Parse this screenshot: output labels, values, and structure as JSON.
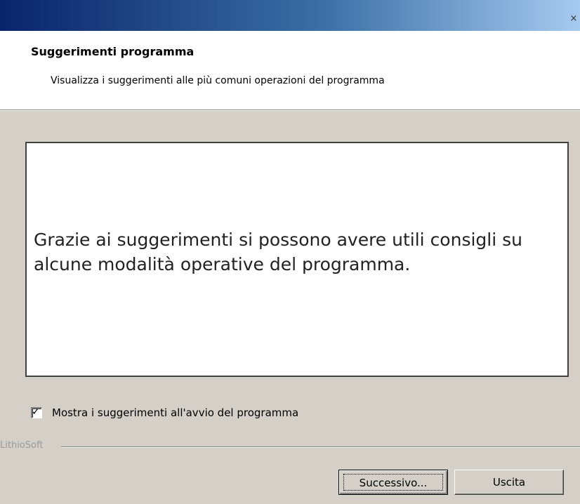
{
  "window": {
    "close_glyph": "×"
  },
  "header": {
    "title": "Suggerimenti programma",
    "subtitle": "Visualizza i suggerimenti alle più comuni operazioni del programma"
  },
  "tip": {
    "text": "Grazie ai suggerimenti si possono avere utili consigli su alcune modalità operative del programma."
  },
  "options": {
    "show_on_startup_label": "Mostra i suggerimenti all'avvio del programma",
    "show_on_startup_checked": true
  },
  "brand": {
    "name": "LithioSoft"
  },
  "buttons": {
    "next_label": "Successivo...",
    "exit_label": "Uscita"
  },
  "colors": {
    "title_gradient_start": "#0a246a",
    "title_gradient_end": "#a6caf0",
    "dialog_bg": "#d4d0c8"
  }
}
